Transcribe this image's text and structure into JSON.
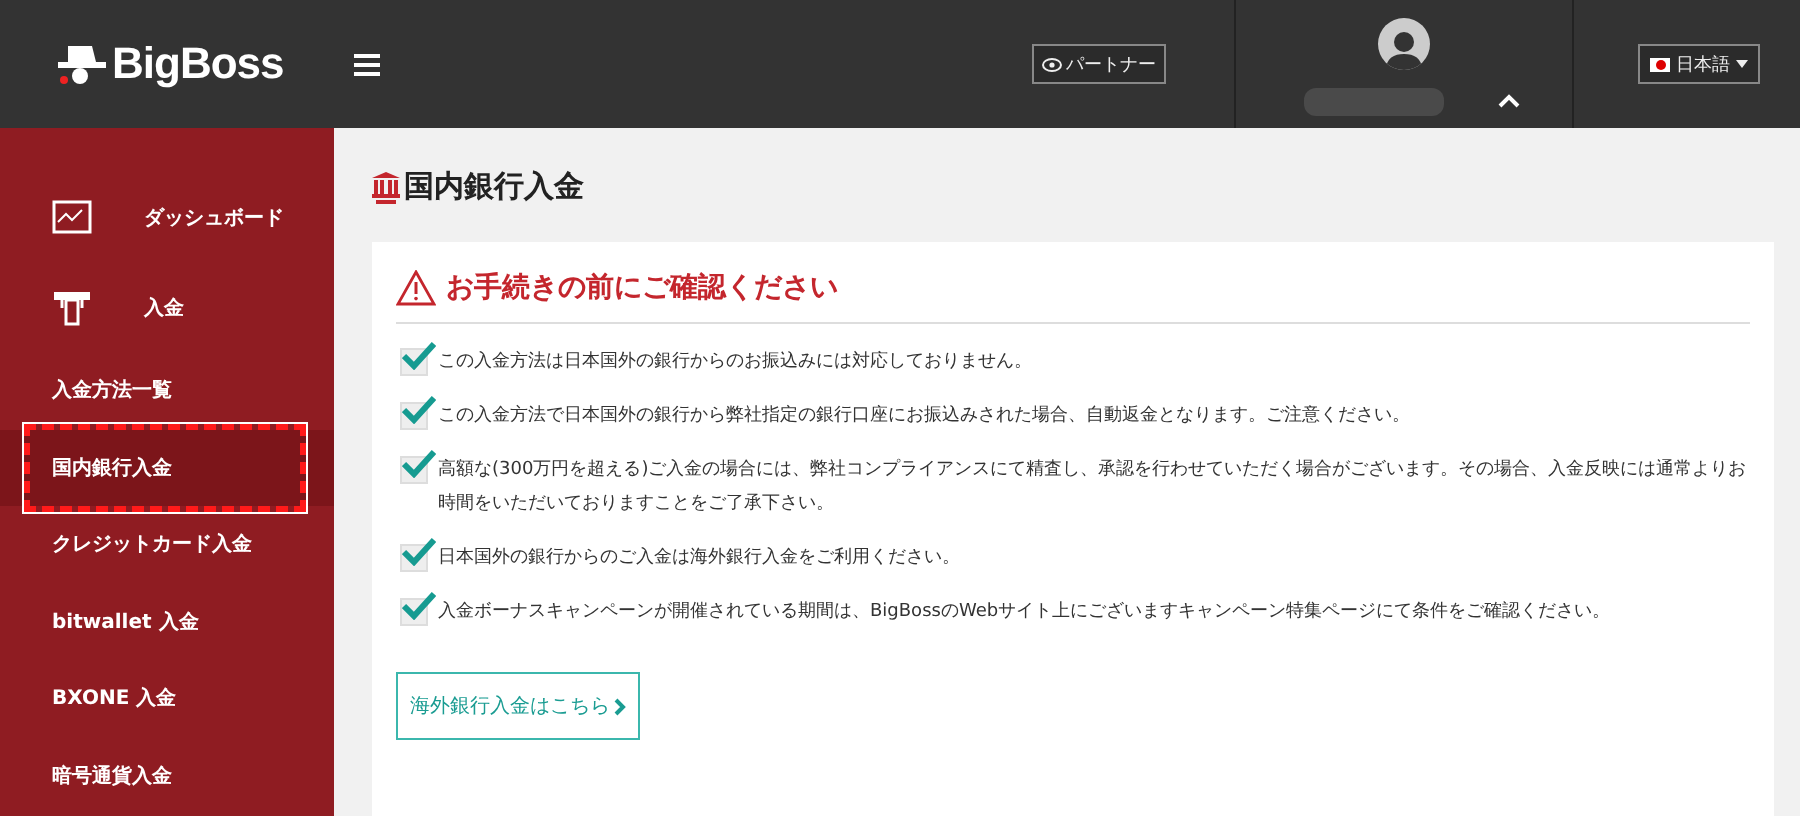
{
  "header": {
    "logo": "BigBoss",
    "partner_button": "パートナー",
    "language_button": "日本語"
  },
  "sidebar": {
    "items": [
      {
        "label": "ダッシュボード",
        "kind": "main",
        "selected": false
      },
      {
        "label": "入金",
        "kind": "main",
        "selected": false
      },
      {
        "label": "入金方法一覧",
        "kind": "sub",
        "selected": false
      },
      {
        "label": "国内銀行入金",
        "kind": "sub",
        "selected": true,
        "highlighted": true
      },
      {
        "label": "クレジットカード入金",
        "kind": "sub",
        "selected": false
      },
      {
        "label": "bitwallet 入金",
        "kind": "sub",
        "selected": false
      },
      {
        "label": "BXONE 入金",
        "kind": "sub",
        "selected": false
      },
      {
        "label": "暗号通貨入金",
        "kind": "sub",
        "selected": false
      }
    ]
  },
  "page_title": "国内銀行入金",
  "notice": {
    "title": "お手続きの前にご確認ください",
    "items": [
      {
        "text": "この入金方法は日本国外の銀行からのお振込みには対応しておりません。",
        "checked": true
      },
      {
        "text": "この入金方法で日本国外の銀行から弊社指定の銀行口座にお振込みされた場合、自動返金となります。ご注意ください。",
        "checked": true
      },
      {
        "text": "高額な(300万円を超える)ご入金の場合には、弊社コンプライアンスにて精査し、承認を行わせていただく場合がございます。その場合、入金反映には通常よりお時間をいただいておりますことをご了承下さい。",
        "checked": true
      },
      {
        "text": "日本国外の銀行からのご入金は海外銀行入金をご利用ください。",
        "checked": true
      },
      {
        "text": "入金ボーナスキャンペーンが開催されている期間は、BigBossのWebサイト上にございますキャンペーン特集ページにて条件をご確認ください。",
        "checked": true
      }
    ],
    "link_button": "海外銀行入金はこちら"
  }
}
